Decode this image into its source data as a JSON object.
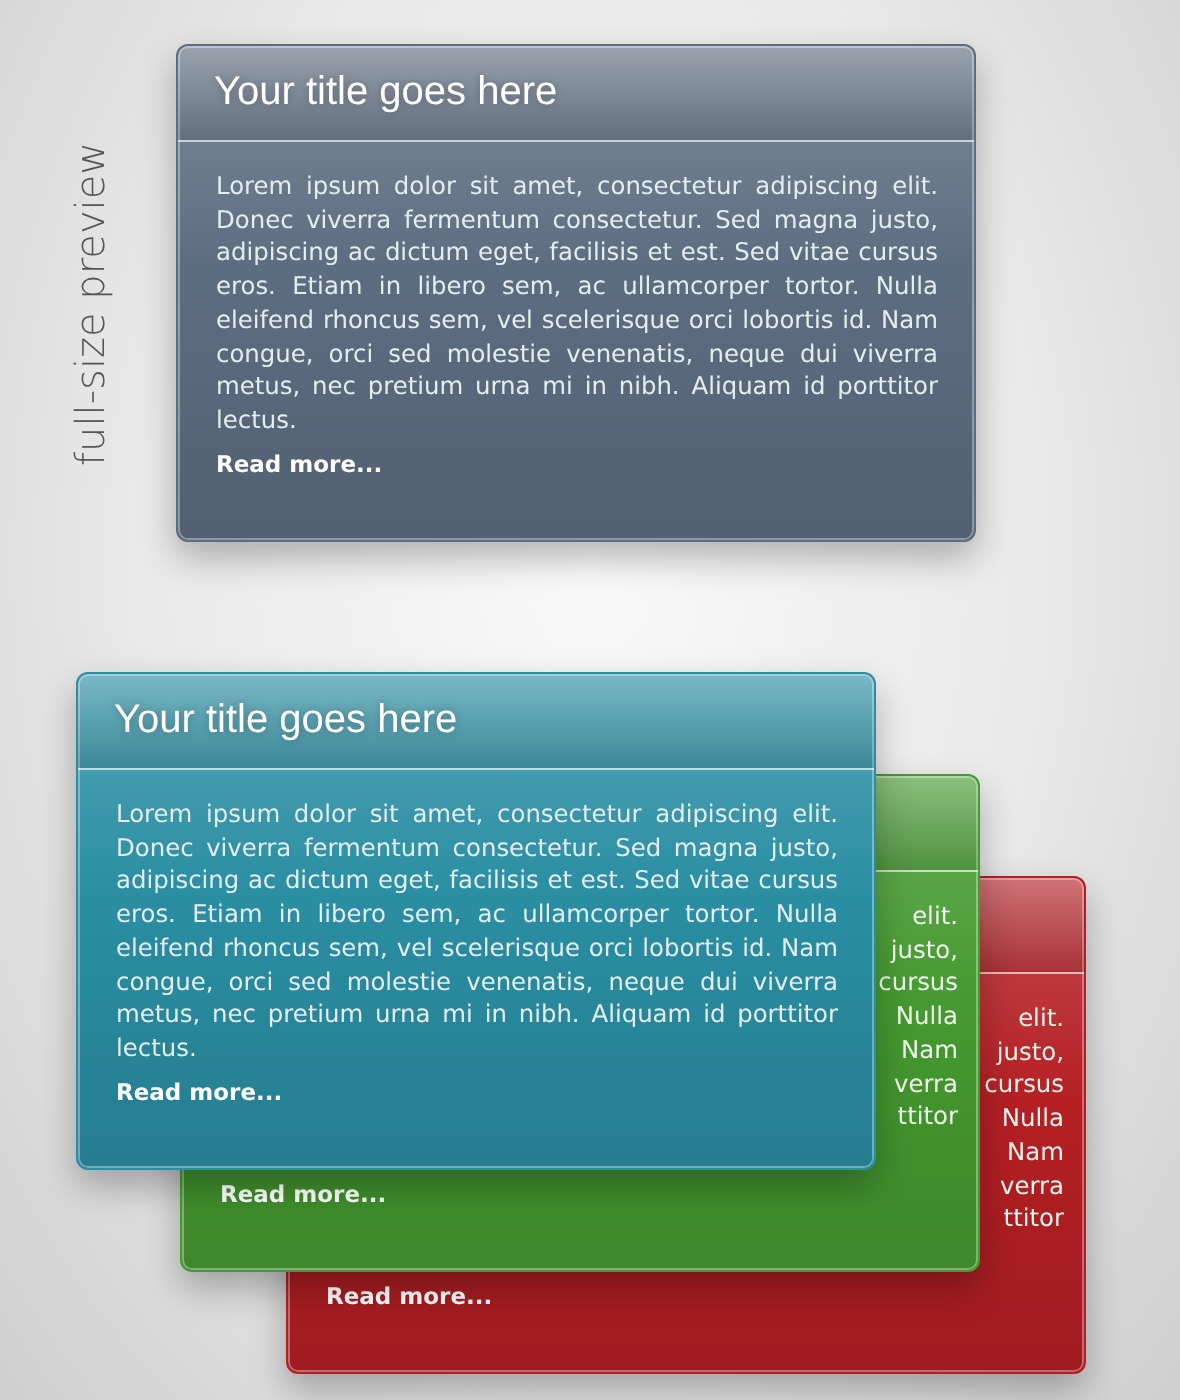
{
  "side_label": "full-size preview",
  "preview_card": {
    "color": "#5d6d80",
    "title": "Your title goes here",
    "body": "Lorem ipsum dolor sit amet, consectetur adipiscing elit. Donec viverra fermentum consectetur. Sed magna justo, adipiscing ac dictum eget, facilisis et est. Sed vitae cursus eros. Etiam in libero sem, ac ullamcorper tortor. Nulla eleifend rhoncus sem, vel scelerisque orci lobortis id. Nam congue, orci sed molestie venenatis, neque dui viverra metus, nec pretium urna mi in nibh. Aliquam id porttitor lectus.",
    "link": "Read more..."
  },
  "stack": [
    {
      "kind": "partial",
      "color": "#b51f24",
      "body_fragments": [
        "elit.",
        "justo,",
        "cursus",
        "Nulla",
        "Nam",
        "verra",
        "ttitor"
      ],
      "link": "Read more..."
    },
    {
      "kind": "partial",
      "color": "#459a30",
      "body_fragments": [
        "elit.",
        "justo,",
        "cursus",
        "Nulla",
        "Nam",
        "verra",
        "ttitor"
      ],
      "link": "Read more..."
    },
    {
      "kind": "full",
      "color": "#2a8ea3",
      "title": "Your title goes here",
      "body": "Lorem ipsum dolor sit amet, consectetur adipiscing elit. Donec viverra fermentum consectetur. Sed magna justo, adipiscing ac dictum eget, facilisis et est. Sed vitae cursus eros. Etiam in libero sem, ac ullamcorper tortor. Nulla eleifend rhoncus sem, vel scelerisque orci lobortis id. Nam congue, orci sed molestie venenatis, neque dui viverra metus, nec pretium urna mi in nibh. Aliquam id porttitor lectus.",
      "link": "Read more..."
    }
  ]
}
